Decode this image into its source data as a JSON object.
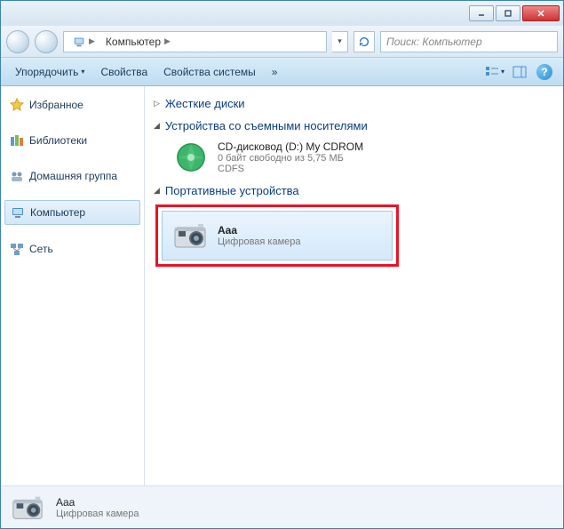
{
  "address": {
    "root_label": "Компьютер"
  },
  "search": {
    "placeholder": "Поиск: Компьютер"
  },
  "toolbar": {
    "organize": "Упорядочить",
    "properties": "Свойства",
    "system_properties": "Свойства системы"
  },
  "sidebar": {
    "favorites": "Избранное",
    "libraries": "Библиотеки",
    "homegroup": "Домашняя группа",
    "computer": "Компьютер",
    "network": "Сеть"
  },
  "groups": {
    "hdd": "Жесткие диски",
    "removable": "Устройства со съемными носителями",
    "portable": "Портативные устройства"
  },
  "cd": {
    "title": "CD-дисковод (D:) My CDROM",
    "free": "0 байт свободно из 5,75 МБ",
    "fs": "CDFS"
  },
  "device": {
    "name": "Aaa",
    "type": "Цифровая камера"
  },
  "status": {
    "name": "Aaa",
    "type": "Цифровая камера"
  }
}
